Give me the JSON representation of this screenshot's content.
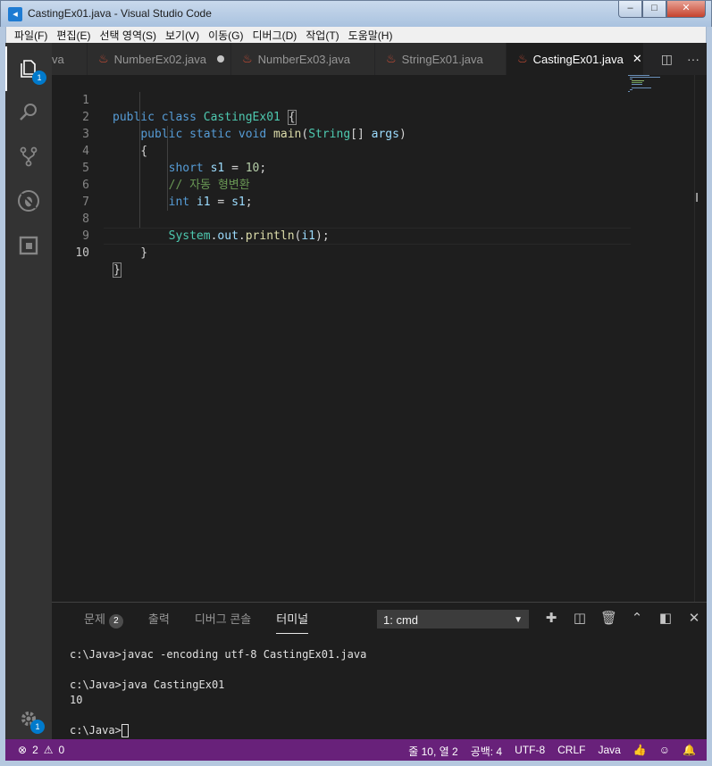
{
  "window": {
    "title": "CastingEx01.java - Visual Studio Code",
    "minimize": "–",
    "maximize": "□",
    "close": "✕"
  },
  "menu": [
    "파일(F)",
    "편집(E)",
    "선택 영역(S)",
    "보기(V)",
    "이동(G)",
    "디버그(D)",
    "작업(T)",
    "도움말(H)"
  ],
  "activity": {
    "explorer_badge": "1",
    "settings_badge": "1"
  },
  "tabs": [
    {
      "label": "va",
      "active": false
    },
    {
      "label": "NumberEx02.java",
      "active": false,
      "dirty": true
    },
    {
      "label": "NumberEx03.java",
      "active": false
    },
    {
      "label": "StringEx01.java",
      "active": false
    },
    {
      "label": "CastingEx01.java",
      "active": true
    }
  ],
  "editor": {
    "line_numbers": [
      "1",
      "2",
      "3",
      "4",
      "5",
      "6",
      "7",
      "8",
      "9",
      "10"
    ],
    "current_line": "10",
    "lines": [
      "public class CastingEx01 {",
      "    public static void main(String[] args)",
      "    {",
      "        short s1 = 10;",
      "        // 자동 형변환",
      "        int i1 = s1;",
      "",
      "        System.out.println(i1);",
      "    }",
      "}"
    ]
  },
  "panel": {
    "tabs": {
      "problems": "문제",
      "problems_count": "2",
      "output": "출력",
      "debug_console": "디버그 콘솔",
      "terminal": "터미널"
    },
    "terminal_select": "1: cmd",
    "terminal_lines": [
      "c:\\Java>javac -encoding utf-8 CastingEx01.java",
      "",
      "c:\\Java>java CastingEx01",
      "10",
      "",
      "c:\\Java>"
    ]
  },
  "status": {
    "errors": "2",
    "warnings": "0",
    "position": "줄 10, 열 2",
    "spaces": "공백: 4",
    "encoding": "UTF-8",
    "eol": "CRLF",
    "language": "Java"
  },
  "colors": {
    "statusbar": "#68217a",
    "accent_badge": "#007acc",
    "java_icon": "#c94c35"
  }
}
